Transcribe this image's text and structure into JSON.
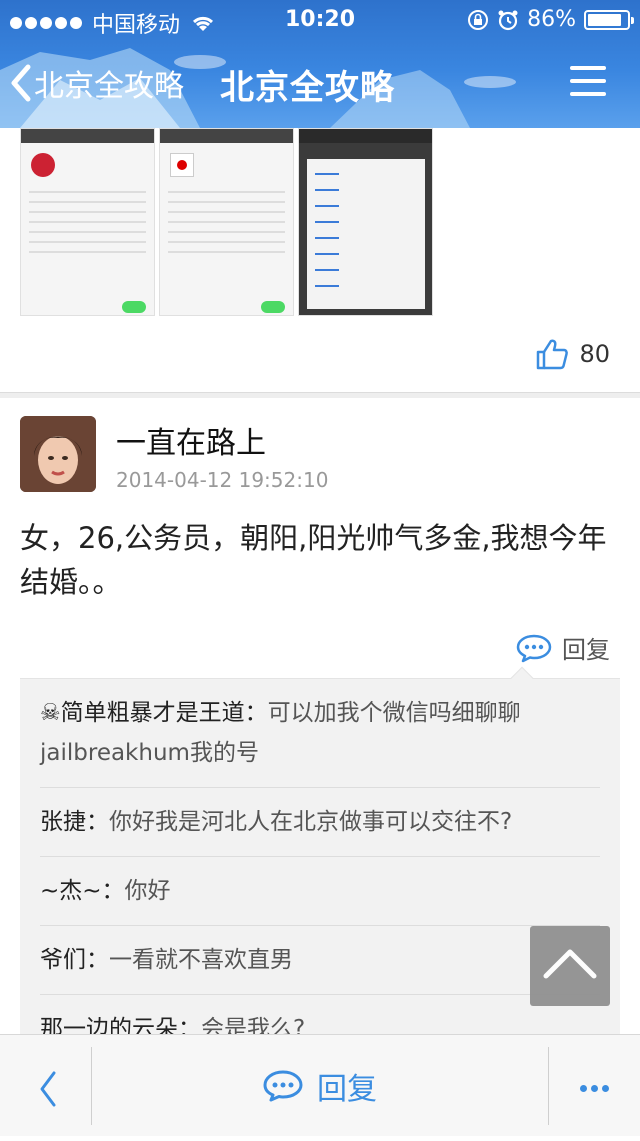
{
  "status_bar": {
    "carrier": "中国移动",
    "time": "10:20",
    "battery": "86%",
    "battery_level": 0.86
  },
  "nav": {
    "back_label": "北京全攻略",
    "title": "北京全攻略"
  },
  "like": {
    "count": "80"
  },
  "post": {
    "username": "一直在路上",
    "timestamp": "2014-04-12 19:52:10",
    "body": "女，26,公务员，朝阳,阳光帅气多金,我想今年结婚。。",
    "reply_label": "回复"
  },
  "comments": [
    {
      "name": "☠简单粗暴才是王道：",
      "text": "可以加我个微信吗细聊聊jailbreakhum我的号"
    },
    {
      "name": "张捷：",
      "text": "你好我是河北人在北京做事可以交往不?"
    },
    {
      "name": "~杰~：",
      "text": "你好"
    },
    {
      "name": "爷们：",
      "text": "一看就不喜欢直男"
    },
    {
      "name": "那一边的云朵：",
      "text": "会是我么?"
    }
  ],
  "toolbar": {
    "reply_label": "回复"
  },
  "colors": {
    "accent": "#3b8de0",
    "header": "#3a86e0"
  }
}
